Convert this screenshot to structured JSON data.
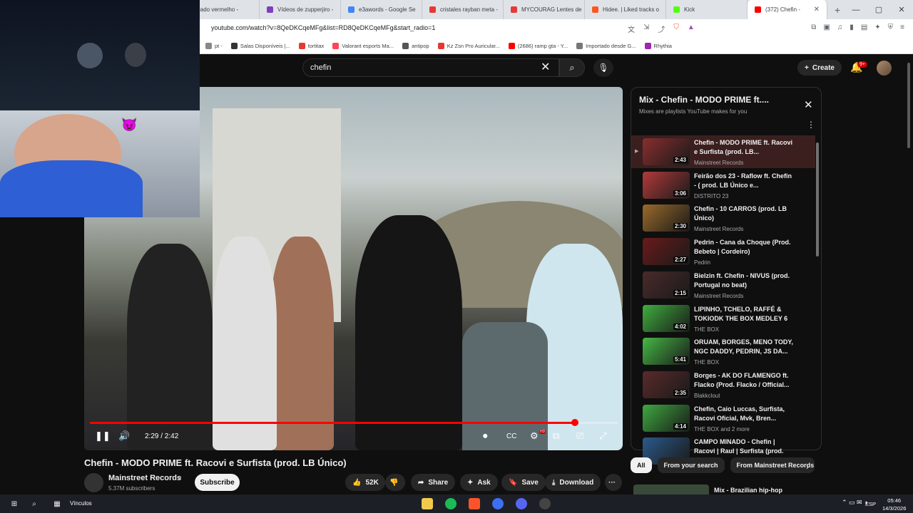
{
  "browser": {
    "tabs": [
      {
        "label": "Nado vermelho - ",
        "color": "#888888"
      },
      {
        "label": "Vídeos de zupperjiro -",
        "color": "#7b3fbf"
      },
      {
        "label": "e3awords - Google Se",
        "color": "#4285f4"
      },
      {
        "label": "cristales rayban meta -",
        "color": "#e53935"
      },
      {
        "label": "MYCOURAG Lentes de",
        "color": "#e53935"
      },
      {
        "label": "Hidee. | Liked tracks o",
        "color": "#ff5722"
      },
      {
        "label": "Kick",
        "color": "#53fc18"
      },
      {
        "label": "(372) Chefin - ",
        "color": "#ff0000"
      }
    ],
    "new_tab": "+",
    "window_controls": [
      "—",
      "▢",
      "✕"
    ],
    "url": "youtube.com/watch?v=8QeDKCqeMFg&list=RD8QeDKCqeMFg&start_radio=1",
    "bookmarks": [
      {
        "label": "pt -",
        "color": "#888888"
      },
      {
        "label": "Salas Disponíveis |...",
        "color": "#333333"
      },
      {
        "label": "tortitax",
        "color": "#e53935"
      },
      {
        "label": "Valorant esports Ma...",
        "color": "#ff4655"
      },
      {
        "label": "antipop",
        "color": "#555555"
      },
      {
        "label": "Kz Zsn Pro Auricular...",
        "color": "#e53935"
      },
      {
        "label": "(2686) ramp gta - Y...",
        "color": "#ff0000"
      },
      {
        "label": "Importado desde G...",
        "color": "#777777"
      },
      {
        "label": "Rhythia",
        "color": "#9c27b0"
      }
    ]
  },
  "youtube": {
    "search_value": "chefin",
    "clear_icon": "✕",
    "search_icon": "⌕",
    "mic_icon": "🎙",
    "create_label": "Create",
    "notifications_badge": "9+",
    "video": {
      "current_time": "2:29",
      "duration": "2:42",
      "time_display": "2:29 / 2:42",
      "progress": 0.92,
      "hd_badge": "HD"
    },
    "title": "Chefin - MODO PRIME ft. Racovi e Surfista (prod. LB Único)",
    "channel": "Mainstreet Records",
    "subscribers": "5.37M subscribers",
    "subscribe_label": "Subscribe",
    "likes": "52K",
    "share_label": "Share",
    "ask_label": "Ask",
    "save_label": "Save",
    "download_label": "Download",
    "more_label": "···"
  },
  "playlist": {
    "title": "Mix - Chefin - MODO PRIME ft....",
    "subtitle": "Mixes are playlists YouTube makes for you",
    "items": [
      {
        "title": "Chefin - MODO PRIME ft. Racovi e Surfista (prod. LB...",
        "channel": "Mainstreet Records",
        "duration": "2:43",
        "thumb_color": "#8a2e2e",
        "active": true
      },
      {
        "title": "Feirão dos 23 - Raflow ft. Chefin - ( prod. LB Único e...",
        "channel": "DISTRITO 23",
        "duration": "3:06",
        "thumb_color": "#b23a3a",
        "active": false
      },
      {
        "title": "Chefin - 10 CARROS (prod. LB Único)",
        "channel": "Mainstreet Records",
        "duration": "2:30",
        "thumb_color": "#9a6a2a",
        "active": false
      },
      {
        "title": "Pedrin - Cana da Choque (Prod. Bebeto | Cordeiro)",
        "channel": "Pedrin",
        "duration": "2:27",
        "thumb_color": "#6a1a1a",
        "active": false
      },
      {
        "title": "Bielzin ft. Chefin - NIVUS (prod. Portugal no beat)",
        "channel": "Mainstreet Records",
        "duration": "2:15",
        "thumb_color": "#4a2a2a",
        "active": false
      },
      {
        "title": "LIPINHO, TCHELO, RAFFÉ & TOKIODK THE BOX MEDLEY 6",
        "channel": "THE BOX",
        "duration": "4:02",
        "thumb_color": "#3fae3f",
        "active": false
      },
      {
        "title": "ORUAM, BORGES, MENO TODY, NGC DADDY, PEDRIN, JS DA...",
        "channel": "THE BOX",
        "duration": "5:41",
        "thumb_color": "#45b845",
        "active": false
      },
      {
        "title": "Borges - AK DO FLAMENGO ft. Flacko (Prod. Flacko / Official...",
        "channel": "Blakkclout",
        "duration": "2:35",
        "thumb_color": "#5a2a2a",
        "active": false
      },
      {
        "title": "Chefin, Caio Luccas, Surfista, Racovi Oficial, Mvk, Bren...",
        "channel": "THE BOX and 2 more",
        "duration": "4:14",
        "thumb_color": "#3fa83f",
        "active": false
      },
      {
        "title": "CAMPO MINADO - Chefin | Racovi | Raul | Surfista (prod. L...",
        "channel": "",
        "duration": "",
        "thumb_color": "#2a5a8a",
        "active": false
      }
    ],
    "chips": [
      "All",
      "From your search",
      "From Mainstreet Records"
    ],
    "next_mix": "Mix - Brazilian hip-hop"
  },
  "taskbar": {
    "search_text": "Vínculos",
    "language": "ESP",
    "time": "05:46",
    "date": "14/3/2026"
  }
}
